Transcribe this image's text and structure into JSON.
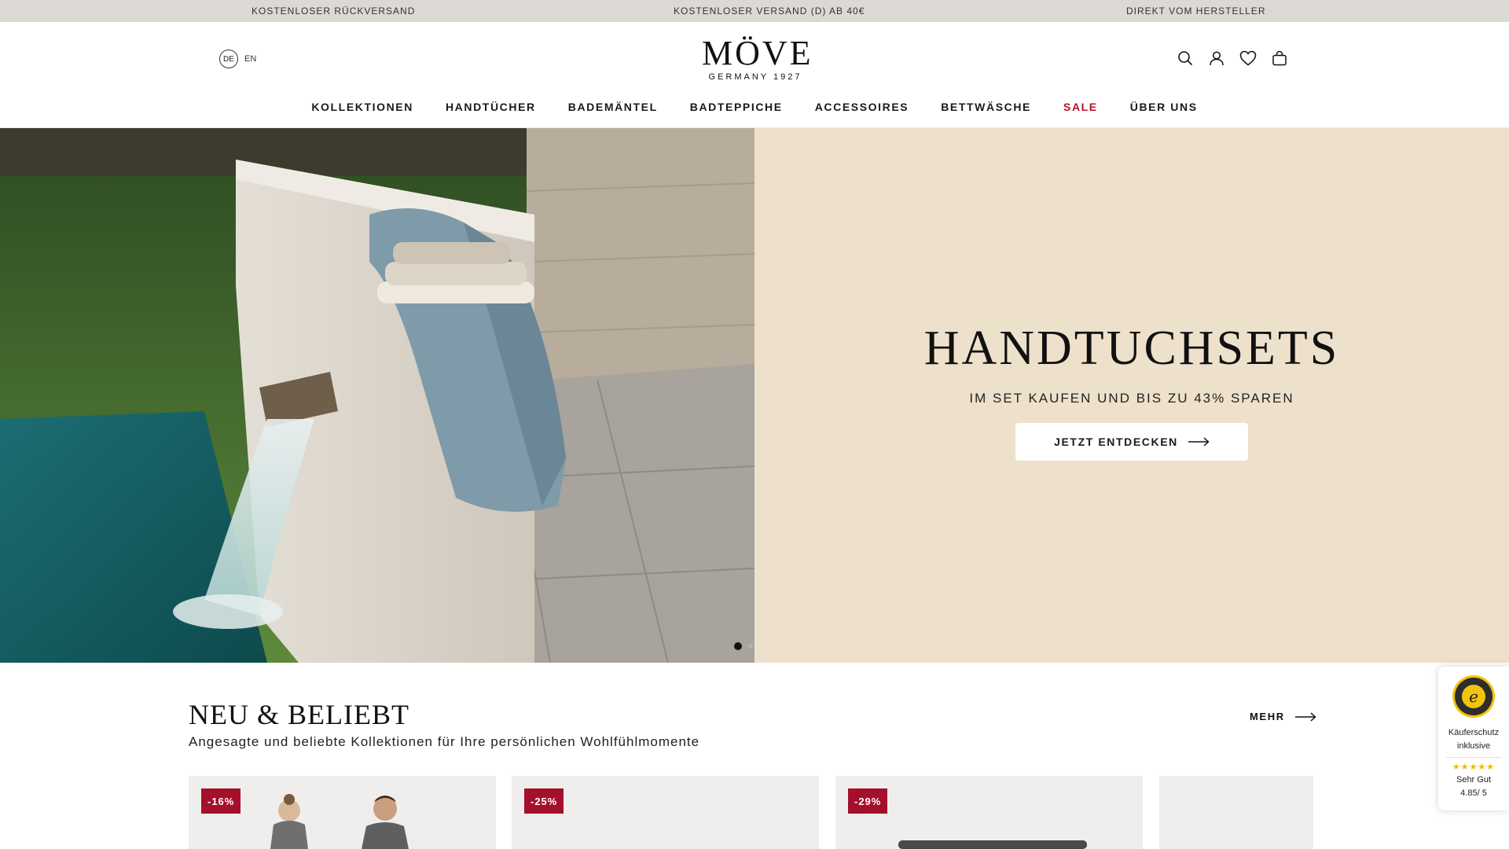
{
  "announcement": {
    "left": "KOSTENLOSER RÜCKVERSAND",
    "center": "KOSTENLOSER VERSAND (D) AB 40€",
    "right": "DIREKT VOM HERSTELLER"
  },
  "header": {
    "lang_active": "DE",
    "lang_other": "EN",
    "logo_text": "MÖVE",
    "logo_sub": "GERMANY 1927",
    "icons": [
      "search-icon",
      "account-icon",
      "wishlist-heart-icon",
      "cart-bag-icon"
    ]
  },
  "nav": {
    "items": [
      "KOLLEKTIONEN",
      "HANDTÜCHER",
      "BADEMÄNTEL",
      "BADTEPPICHE",
      "ACCESSOIRES",
      "BETTWÄSCHE",
      "SALE",
      "ÜBER UNS"
    ]
  },
  "hero": {
    "title": "HANDTUCHSETS",
    "subtitle": "IM SET KAUFEN UND BIS ZU 43% SPAREN",
    "cta": "JETZT ENTDECKEN",
    "slides_total": 2,
    "slide_active": 1,
    "panel_color": "#ede1cc"
  },
  "section": {
    "title": "NEU & BELIEBT",
    "subtitle": "Angesagte und beliebte Kollektionen für Ihre persönlichen Wohlfühlmomente",
    "more": "MEHR"
  },
  "products": [
    {
      "badge": "-16%"
    },
    {
      "badge": "-25%"
    },
    {
      "badge": "-29%"
    },
    {
      "badge": ""
    }
  ],
  "trusted_shops": {
    "label_line1": "Käuferschutz",
    "label_line2": "inklusive",
    "stars": "★★★★★",
    "rating_text": "Sehr Gut",
    "score": "4.85/ 5"
  },
  "colors": {
    "sale": "#b4122e",
    "badge": "#a4102b",
    "topbar": "#dcd9d4"
  }
}
